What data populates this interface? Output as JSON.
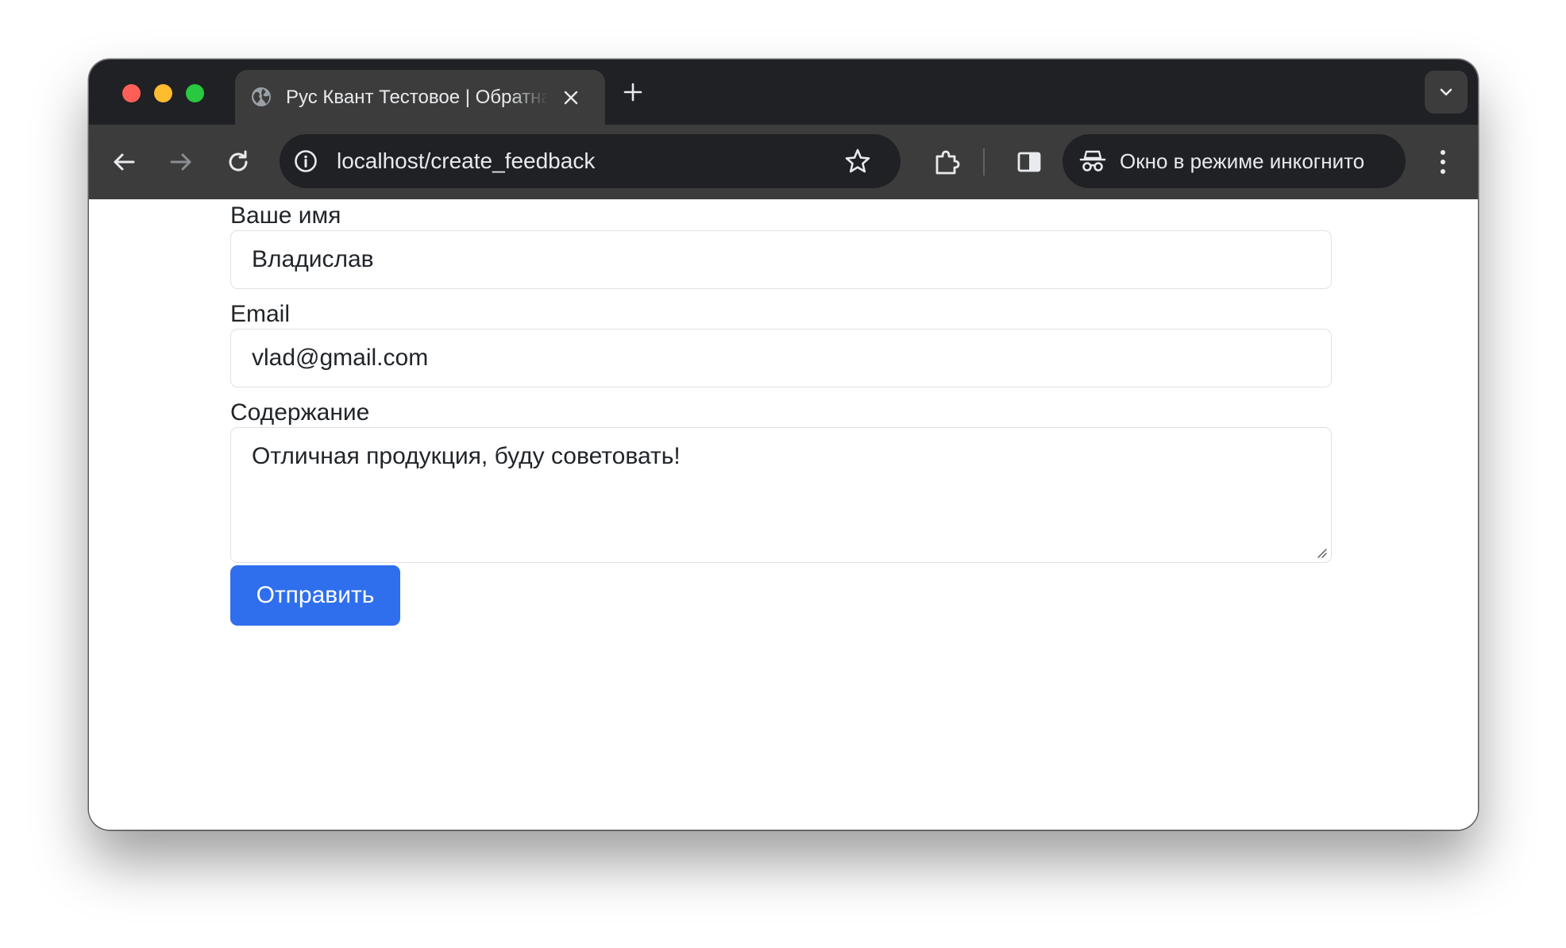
{
  "browser": {
    "tab": {
      "title": "Рус Квант Тестовое | Обратная связь",
      "icon": "globe-icon"
    },
    "address_bar": {
      "url": "localhost/create_feedback"
    },
    "incognito": {
      "label": "Окно в режиме инкогнито"
    }
  },
  "form": {
    "name": {
      "label": "Ваше имя",
      "value": "Владислав"
    },
    "email": {
      "label": "Email",
      "value": "vlad@gmail.com"
    },
    "content": {
      "label": "Содержание",
      "value": "Отличная продукция, буду советовать!"
    },
    "submit_label": "Отправить"
  },
  "colors": {
    "tab_strip": "#202124",
    "toolbar": "#3c3c3c",
    "primary_button": "#2f6fed",
    "input_border": "#dee2e6",
    "text": "#212529"
  }
}
